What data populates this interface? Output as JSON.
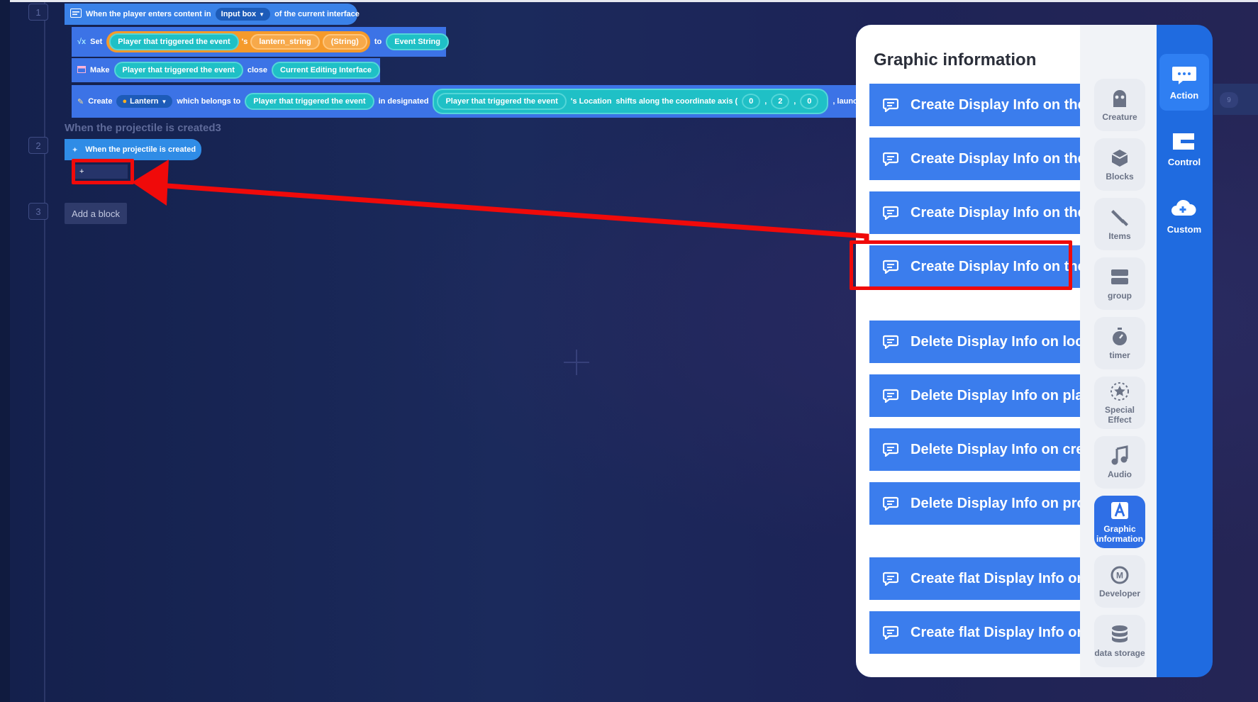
{
  "steps": [
    "1",
    "2",
    "3"
  ],
  "block1": {
    "event_prefix": "When the player enters content in",
    "input_dropdown": "Input box",
    "event_suffix": "of the current interface"
  },
  "block2": {
    "set_label": "Set",
    "player": "Player that triggered the event",
    "possessive": "'s",
    "variable": "lantern_string",
    "type": "(String)",
    "to_label": "to",
    "value": "Event String"
  },
  "block3": {
    "make_label": "Make",
    "player": "Player that triggered the event",
    "close_label": "close",
    "target": "Current Editing Interface"
  },
  "block4": {
    "create_label": "Create",
    "item_dropdown": "Lantern",
    "belongs_label": "which belongs to",
    "player": "Player that triggered the event",
    "designated_label": "in designated",
    "player2": "Player that triggered the event",
    "location_label": "'s Location",
    "shift_label": "shifts along the coordinate axis (",
    "coords": [
      "0",
      "2",
      "0"
    ],
    "launch_label": ", launc",
    "overflow_value": "9"
  },
  "section2": {
    "title": "When the projectile is created3",
    "event": "When the projectile is created",
    "slot": "+"
  },
  "add_block_label": "Add a block",
  "panel": {
    "title": "Graphic information",
    "options": [
      "Create Display Info on the l",
      "Create Display Info on the p",
      "Create Display Info on the C",
      "Create Display Info on the P",
      "Delete Display Info on locat",
      "Delete Display Info on playe",
      "Delete Display Info on creat",
      "Delete Display Info on proje",
      "Create flat Display Info on t",
      "Create flat Display Info on t"
    ],
    "categories": [
      {
        "label": "Creature",
        "icon": "creature-icon"
      },
      {
        "label": "Blocks",
        "icon": "cube-icon"
      },
      {
        "label": "Items",
        "icon": "sword-icon"
      },
      {
        "label": "group",
        "icon": "group-icon"
      },
      {
        "label": "timer",
        "icon": "timer-icon"
      },
      {
        "label": "Special Effect",
        "icon": "star-icon"
      },
      {
        "label": "Audio",
        "icon": "music-icon"
      },
      {
        "label": "Graphic information",
        "icon": "graphic-icon"
      },
      {
        "label": "Developer",
        "icon": "developer-icon"
      },
      {
        "label": "data storage",
        "icon": "database-icon"
      }
    ],
    "side_tabs": [
      "Action",
      "Control",
      "Custom"
    ]
  },
  "colors": {
    "accent": "#3b7ded",
    "highlight": "#f00a0a",
    "block_blue": "#3c73e6",
    "pill_teal": "#1fc0c6",
    "orange": "#f59a2b"
  }
}
